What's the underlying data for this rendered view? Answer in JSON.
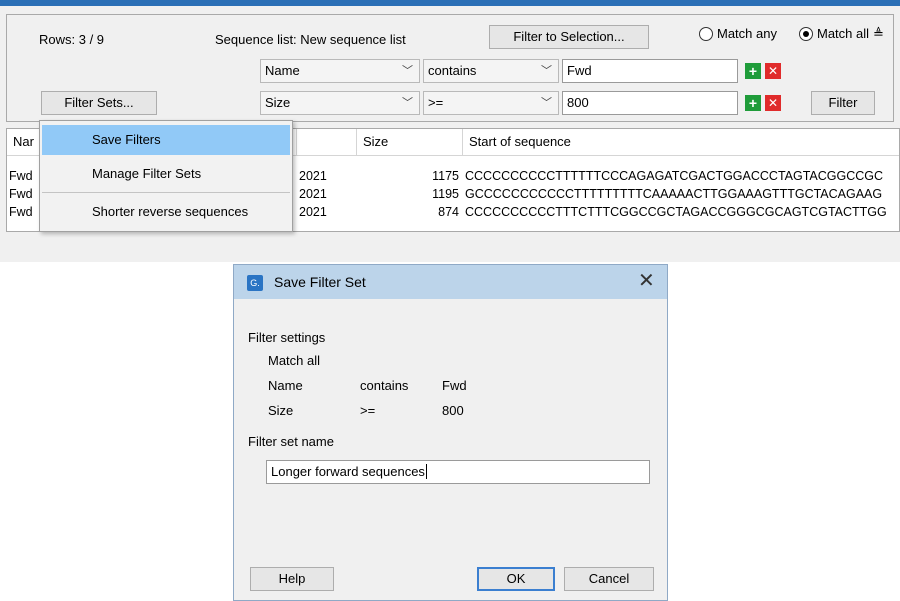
{
  "toolbar": {
    "rows_label": "Rows: 3 / 9",
    "sequence_list_label": "Sequence list: New sequence list",
    "filter_to_selection_label": "Filter to Selection...",
    "match_any_label": "Match any",
    "match_all_label": "Match all",
    "match_mode_selected": "Match all",
    "filter_sets_label": "Filter Sets...",
    "filter_button_label": "Filter",
    "filters": [
      {
        "field": "Name",
        "operator": "contains",
        "value": "Fwd"
      },
      {
        "field": "Size",
        "operator": ">=",
        "value": "800"
      }
    ]
  },
  "table": {
    "headers": [
      "Nar",
      "",
      "Size",
      "Start of sequence"
    ],
    "rows": [
      {
        "name": "Fwd",
        "date": "2021",
        "size": "1175",
        "seq": "CCCCCCCCCCTTTTTTCCCAGAGATCGACTGGACCCTAGTACGGCCGC"
      },
      {
        "name": "Fwd",
        "date": "2021",
        "size": "1195",
        "seq": "GCCCCCCCCCCCTTTTTTTTTCAAAAACTTGGAAAGTTTGCTACAGAAG"
      },
      {
        "name": "Fwd",
        "date": "2021",
        "size": "874",
        "seq": "CCCCCCCCCCTTTCTTTCGGCCGCTAGACCGGGCGCAGTCGTACTTGG"
      }
    ]
  },
  "menu": {
    "items": [
      {
        "label": "Save Filters",
        "selected": true
      },
      {
        "label": "Manage Filter Sets",
        "selected": false
      },
      {
        "label": "Shorter reverse sequences",
        "selected": false
      }
    ]
  },
  "dialog": {
    "title": "Save Filter Set",
    "app_icon_text": "G.",
    "section_label": "Filter settings",
    "match_mode": "Match all",
    "rules": [
      {
        "field": "Name",
        "operator": "contains",
        "value": "Fwd"
      },
      {
        "field": "Size",
        "operator": ">=",
        "value": "800"
      }
    ],
    "name_label": "Filter set name",
    "name_value": "Longer forward sequences",
    "help_label": "Help",
    "ok_label": "OK",
    "cancel_label": "Cancel"
  },
  "colors": {
    "accent_bar": "#2b6fb6",
    "menu_highlight": "#91c9f7",
    "dialog_titlebar": "#bcd4ea",
    "add_green": "#1f9c3a",
    "remove_red": "#e02b2b"
  }
}
